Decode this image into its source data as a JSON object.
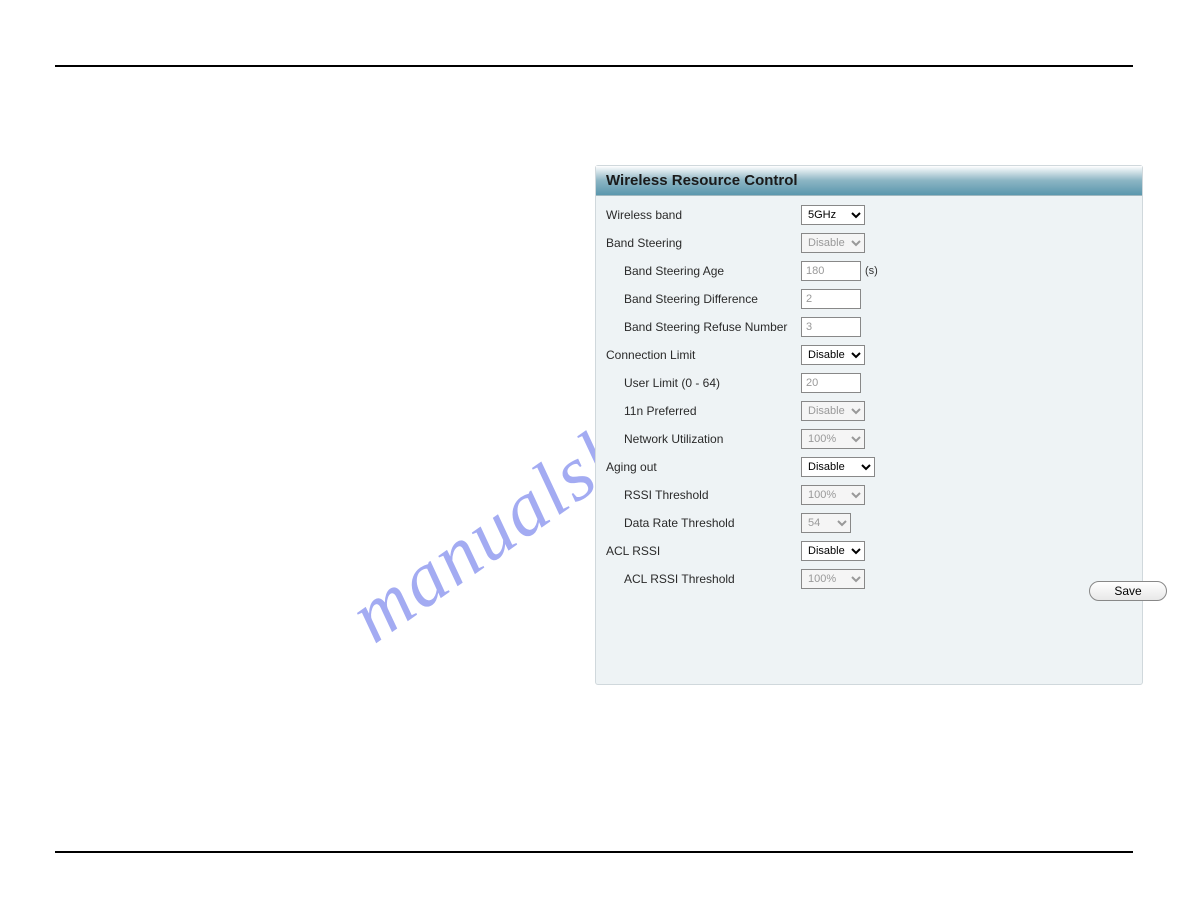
{
  "watermark": "manualshive.com",
  "panel": {
    "title": "Wireless Resource Control",
    "fields": {
      "wireless_band": {
        "label": "Wireless band",
        "value": "5GHz"
      },
      "band_steering": {
        "label": "Band Steering",
        "value": "Disable"
      },
      "band_steering_age": {
        "label": "Band Steering Age",
        "value": "180",
        "unit": "(s)"
      },
      "band_steering_difference": {
        "label": "Band Steering Difference",
        "value": "2"
      },
      "band_steering_refuse": {
        "label": "Band Steering Refuse Number",
        "value": "3"
      },
      "connection_limit": {
        "label": "Connection Limit",
        "value": "Disable"
      },
      "user_limit": {
        "label": "User Limit (0 - 64)",
        "value": "20"
      },
      "eleven_n_preferred": {
        "label": "11n Preferred",
        "value": "Disable"
      },
      "network_utilization": {
        "label": "Network Utilization",
        "value": "100%"
      },
      "aging_out": {
        "label": "Aging out",
        "value": "Disable"
      },
      "rssi_threshold": {
        "label": "RSSI Threshold",
        "value": "100%"
      },
      "data_rate_threshold": {
        "label": "Data Rate Threshold",
        "value": "54"
      },
      "acl_rssi": {
        "label": "ACL RSSI",
        "value": "Disable"
      },
      "acl_rssi_threshold": {
        "label": "ACL RSSI Threshold",
        "value": "100%"
      }
    },
    "save_button": "Save"
  }
}
